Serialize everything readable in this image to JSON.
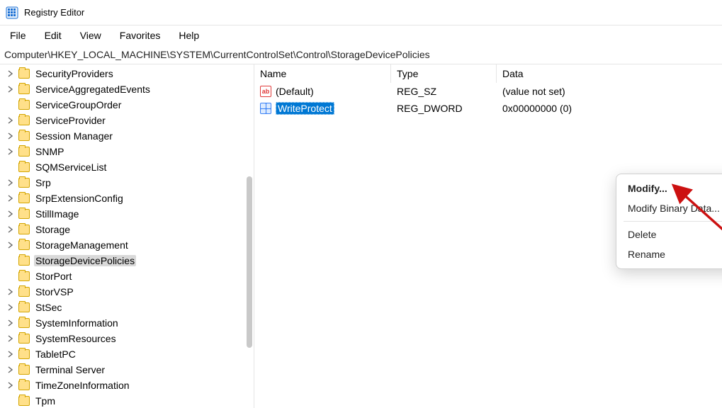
{
  "app": {
    "title": "Registry Editor"
  },
  "menu": {
    "items": [
      "File",
      "Edit",
      "View",
      "Favorites",
      "Help"
    ]
  },
  "address": "Computer\\HKEY_LOCAL_MACHINE\\SYSTEM\\CurrentControlSet\\Control\\StorageDevicePolicies",
  "tree": {
    "items": [
      {
        "label": "SecurityProviders",
        "expandable": true,
        "selected": false
      },
      {
        "label": "ServiceAggregatedEvents",
        "expandable": true,
        "selected": false
      },
      {
        "label": "ServiceGroupOrder",
        "expandable": false,
        "selected": false
      },
      {
        "label": "ServiceProvider",
        "expandable": true,
        "selected": false
      },
      {
        "label": "Session Manager",
        "expandable": true,
        "selected": false
      },
      {
        "label": "SNMP",
        "expandable": true,
        "selected": false
      },
      {
        "label": "SQMServiceList",
        "expandable": false,
        "selected": false
      },
      {
        "label": "Srp",
        "expandable": true,
        "selected": false
      },
      {
        "label": "SrpExtensionConfig",
        "expandable": true,
        "selected": false
      },
      {
        "label": "StillImage",
        "expandable": true,
        "selected": false
      },
      {
        "label": "Storage",
        "expandable": true,
        "selected": false
      },
      {
        "label": "StorageManagement",
        "expandable": true,
        "selected": false
      },
      {
        "label": "StorageDevicePolicies",
        "expandable": false,
        "selected": true
      },
      {
        "label": "StorPort",
        "expandable": false,
        "selected": false
      },
      {
        "label": "StorVSP",
        "expandable": true,
        "selected": false
      },
      {
        "label": "StSec",
        "expandable": true,
        "selected": false
      },
      {
        "label": "SystemInformation",
        "expandable": true,
        "selected": false
      },
      {
        "label": "SystemResources",
        "expandable": true,
        "selected": false
      },
      {
        "label": "TabletPC",
        "expandable": true,
        "selected": false
      },
      {
        "label": "Terminal Server",
        "expandable": true,
        "selected": false
      },
      {
        "label": "TimeZoneInformation",
        "expandable": true,
        "selected": false
      },
      {
        "label": "Tpm",
        "expandable": false,
        "selected": false
      }
    ]
  },
  "list": {
    "columns": {
      "name": "Name",
      "type": "Type",
      "data": "Data"
    },
    "rows": [
      {
        "icon": "sz",
        "name": "(Default)",
        "type": "REG_SZ",
        "data": "(value not set)",
        "selected": false
      },
      {
        "icon": "dw",
        "name": "WriteProtect",
        "type": "REG_DWORD",
        "data": "0x00000000 (0)",
        "selected": true
      }
    ]
  },
  "contextMenu": {
    "modify": "Modify...",
    "modifyBinary": "Modify Binary Data...",
    "delete": "Delete",
    "rename": "Rename"
  },
  "icons": {
    "sz_glyph": "ab"
  }
}
